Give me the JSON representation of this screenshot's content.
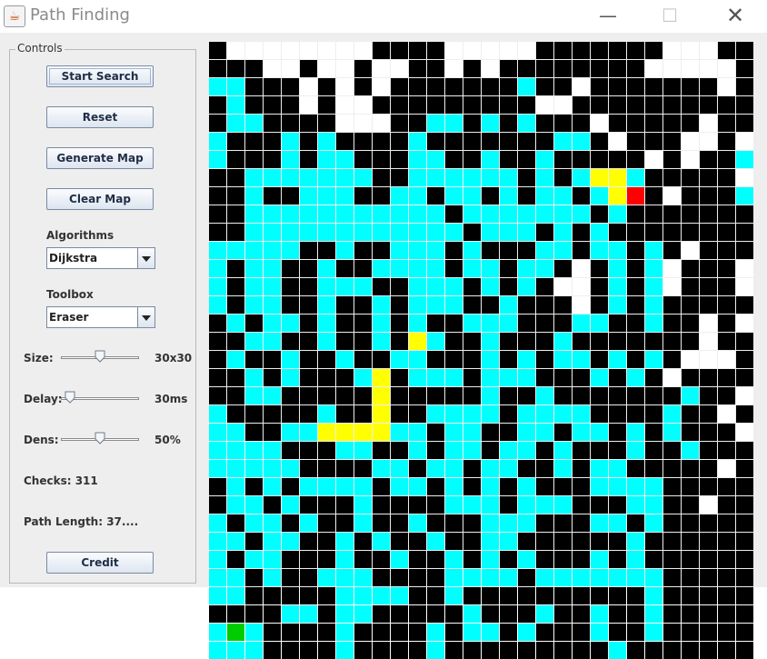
{
  "window": {
    "title": "Path Finding",
    "icon": "java-cup-icon",
    "min_glyph": "—",
    "max_glyph": "☐",
    "close_glyph": "✕"
  },
  "controls": {
    "group_title": "Controls",
    "start_search": "Start Search",
    "reset": "Reset",
    "generate_map": "Generate Map",
    "clear_map": "Clear Map",
    "algorithms_label": "Algorithms",
    "algorithm_value": "Dijkstra",
    "toolbox_label": "Toolbox",
    "toolbox_value": "Eraser",
    "size_label": "Size:",
    "size_value": "30x30",
    "size_level": 0.5,
    "delay_label": "Delay:",
    "delay_value": "30ms",
    "delay_level": 0.05,
    "dens_label": "Dens:",
    "dens_value": "50%",
    "dens_level": 0.5,
    "checks": "Checks: 311",
    "path_length": "Path Length: 37....",
    "credit": "Credit"
  },
  "grid": {
    "cols": 30,
    "colors": {
      ".": "#000000",
      "W": "#ffffff",
      "C": "#00ffff",
      "Y": "#ffff00",
      "R": "#ff0000",
      "G": "#00cc00"
    },
    "rows": [
      ".WWWWWWWW....WWWWW.......WWW..",
      "...WW.WW.WW..W.W........WWWWW.",
      "CC...W.W.W.......C..W.......W.",
      ".C...W.WW.........WW..........",
      ".CC....WWW..CC.C.C...W.....W..",
      "C...C.C....C.......CC.W...WW.W",
      "C...C.CC...CC..C..C.....W.W..C",
      "..CCCCCCC..CCCCCC.C.CYYC.....W",
      "..C..CCC..CC.CC.C.CC.CYR.W...C",
      "..CCCCCCCCCCC.CCCCCCC.C.......",
      "..CCCCCCCCCCCC.CCC.C.C........",
      "CCCCC..C..CCC.C...CC.CC.C.W...",
      "C.CC..C..CCCC.CC.CC.W.C.CW...W",
      "C.CC..CCC..CCC.C.C.WW.C.CW...W",
      "C.CC..C..C.CCC..C...W.C.C.....",
      ".C.CC.C..C.C..CCC...CC..C..W.W",
      "..CC..C..C.YC..C...C.......W..",
      ".C..C..C..CC...C.C.CC.C.C.WWW.",
      "..C.C...CY.CCC.CCC...C.C.W....",
      "..CC.....Y.....C..C.......C..W",
      "C.....C..Y..CCCC.CCCC....C..W.",
      "CC..CCYYYYCC.CC..CC.CC.C.C...W",
      "CCCC...CC..C.CC.CC.C...C..C...",
      "CCCCC....CC.CC.CC..C.CC.....W.",
      ".C.C.CCCC.CC.C.C.C...CCCC.....",
      ".CC.C...C....CCC.CCC...CC..W..",
      "C.CC.C..C..C...CCC...CC.C.....",
      "CC.CC..C.C..C..CC......C......",
      "C.CC...C..C..C.C.C...C.C......",
      "CC.C..CCC....CCCC.CCCCCCC.....",
      "CC.....CCCC..C..........C.....",
      "....CC.CC.....C...C..C..C.....",
      "CGC....C....C.CC.C...C..C.....",
      "CCC....C....C.........C......."
    ],
    "overlay": [
      "..............................",
      "..............................",
      "..............................",
      "..............................",
      "..............................",
      "..............................",
      "..............................",
      "..............................",
      "..............................",
      "..............................",
      "..............................",
      "..............................",
      "..............................",
      "..............................",
      "..............................",
      "..............................",
      "..............................",
      "..............................",
      "..............................",
      "..............................",
      "..............................",
      "..............................",
      "..............................",
      "..............................",
      "..............................",
      "..............................",
      "..............................",
      "..............................",
      "..............................",
      "..............................",
      "..............................",
      "..............................",
      "..............................",
      ".............................."
    ]
  }
}
